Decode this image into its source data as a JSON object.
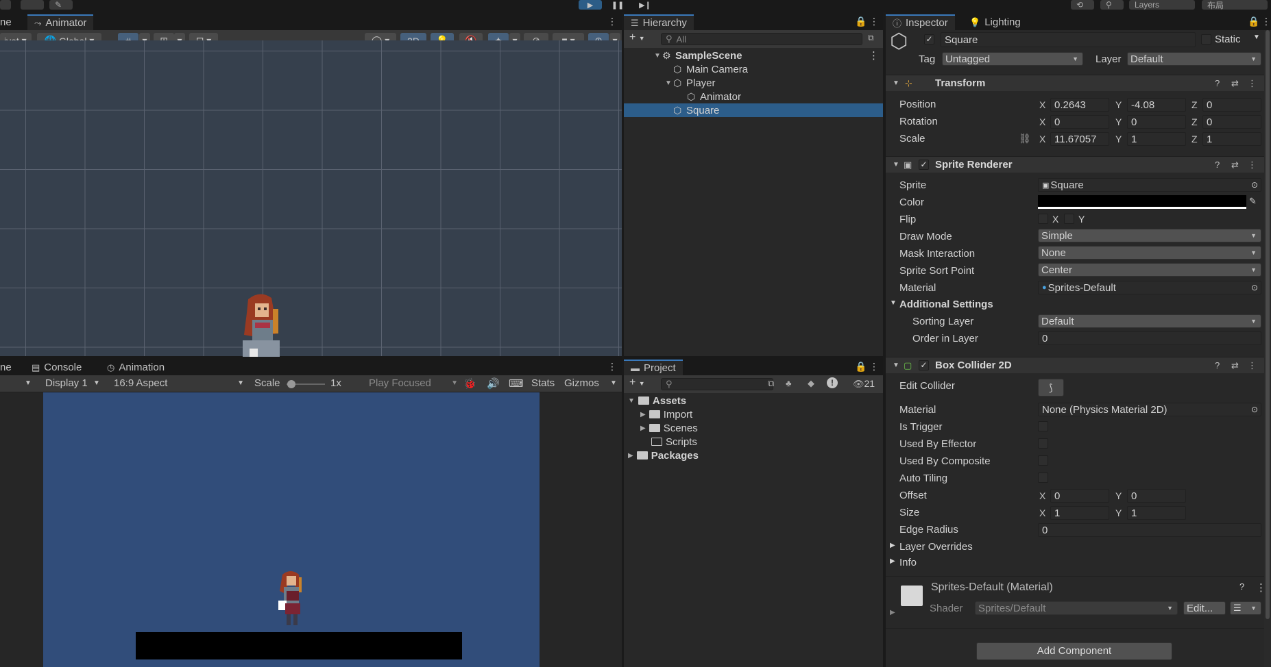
{
  "topbar": {
    "layers_label": "Layers",
    "layout_label": "布局"
  },
  "scene_panel": {
    "tab_scene_fragment": "ne",
    "tab_animator": "Animator",
    "pivot_label": "ivot",
    "global_label": "Global",
    "mode_2d": "2D"
  },
  "game_panel": {
    "tab_game_fragment": "ne",
    "tab_console": "Console",
    "tab_animation": "Animation",
    "display": "Display 1",
    "aspect": "16:9 Aspect",
    "scale_label": "Scale",
    "scale_value": "1x",
    "play_focused": "Play Focused",
    "stats": "Stats",
    "gizmos": "Gizmos"
  },
  "hierarchy": {
    "tab": "Hierarchy",
    "search_placeholder": "All",
    "items": [
      {
        "label": "SampleScene",
        "depth": 0,
        "expanded": true,
        "selected": false
      },
      {
        "label": "Main Camera",
        "depth": 1,
        "expanded": null,
        "selected": false
      },
      {
        "label": "Player",
        "depth": 1,
        "expanded": true,
        "selected": false
      },
      {
        "label": "Animator",
        "depth": 2,
        "expanded": null,
        "selected": false
      },
      {
        "label": "Square",
        "depth": 1,
        "expanded": null,
        "selected": true
      }
    ]
  },
  "project": {
    "tab": "Project",
    "hidden_count": "21",
    "items": [
      {
        "label": "Assets",
        "depth": 0,
        "expanded": true
      },
      {
        "label": "Import",
        "depth": 1,
        "expanded": false
      },
      {
        "label": "Scenes",
        "depth": 1,
        "expanded": false
      },
      {
        "label": "Scripts",
        "depth": 1,
        "expanded": null
      },
      {
        "label": "Packages",
        "depth": 0,
        "expanded": false
      }
    ]
  },
  "inspector": {
    "tab_inspector": "Inspector",
    "tab_lighting": "Lighting",
    "object_name": "Square",
    "static_label": "Static",
    "tag_label": "Tag",
    "tag_value": "Untagged",
    "layer_label": "Layer",
    "layer_value": "Default",
    "transform": {
      "title": "Transform",
      "position_label": "Position",
      "rotation_label": "Rotation",
      "scale_label": "Scale",
      "position": {
        "x": "0.2643",
        "y": "-4.08",
        "z": "0"
      },
      "rotation": {
        "x": "0",
        "y": "0",
        "z": "0"
      },
      "scale": {
        "x": "11.67057",
        "y": "1",
        "z": "1"
      }
    },
    "sprite_renderer": {
      "title": "Sprite Renderer",
      "sprite_label": "Sprite",
      "sprite_value": "Square",
      "color_label": "Color",
      "flip_label": "Flip",
      "flip_x": "X",
      "flip_y": "Y",
      "draw_mode_label": "Draw Mode",
      "draw_mode_value": "Simple",
      "mask_label": "Mask Interaction",
      "mask_value": "None",
      "sort_point_label": "Sprite Sort Point",
      "sort_point_value": "Center",
      "material_label": "Material",
      "material_value": "Sprites-Default",
      "additional_label": "Additional Settings",
      "sorting_layer_label": "Sorting Layer",
      "sorting_layer_value": "Default",
      "order_label": "Order in Layer",
      "order_value": "0"
    },
    "box_collider": {
      "title": "Box Collider 2D",
      "edit_collider_label": "Edit Collider",
      "material_label": "Material",
      "material_value": "None (Physics Material 2D)",
      "is_trigger_label": "Is Trigger",
      "effector_label": "Used By Effector",
      "composite_label": "Used By Composite",
      "auto_tiling_label": "Auto Tiling",
      "offset_label": "Offset",
      "offset": {
        "x": "0",
        "y": "0"
      },
      "size_label": "Size",
      "size": {
        "x": "1",
        "y": "1"
      },
      "edge_radius_label": "Edge Radius",
      "edge_radius_value": "0",
      "layer_overrides_label": "Layer Overrides",
      "info_label": "Info"
    },
    "material": {
      "title": "Sprites-Default (Material)",
      "shader_label": "Shader",
      "shader_value": "Sprites/Default",
      "edit_button": "Edit..."
    },
    "add_component": "Add Component"
  },
  "colors": {
    "accent": "#3a79bb",
    "selection": "#2c5d8a",
    "game_background": "#314d7a",
    "scene_background": "#36404d"
  }
}
